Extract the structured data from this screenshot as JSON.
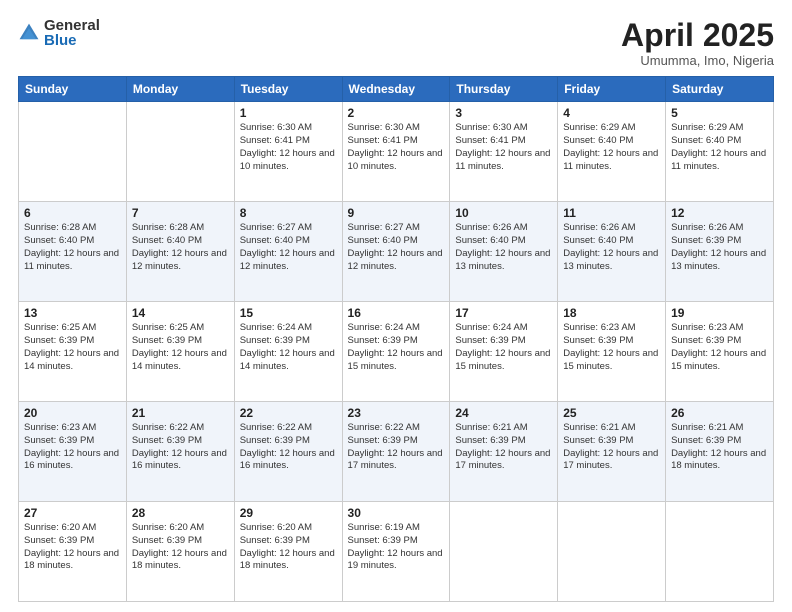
{
  "logo": {
    "general": "General",
    "blue": "Blue"
  },
  "header": {
    "title": "April 2025",
    "subtitle": "Umumma, Imo, Nigeria"
  },
  "weekdays": [
    "Sunday",
    "Monday",
    "Tuesday",
    "Wednesday",
    "Thursday",
    "Friday",
    "Saturday"
  ],
  "weeks": [
    [
      {
        "day": "",
        "sunrise": "",
        "sunset": "",
        "daylight": ""
      },
      {
        "day": "",
        "sunrise": "",
        "sunset": "",
        "daylight": ""
      },
      {
        "day": "1",
        "sunrise": "Sunrise: 6:30 AM",
        "sunset": "Sunset: 6:41 PM",
        "daylight": "Daylight: 12 hours and 10 minutes."
      },
      {
        "day": "2",
        "sunrise": "Sunrise: 6:30 AM",
        "sunset": "Sunset: 6:41 PM",
        "daylight": "Daylight: 12 hours and 10 minutes."
      },
      {
        "day": "3",
        "sunrise": "Sunrise: 6:30 AM",
        "sunset": "Sunset: 6:41 PM",
        "daylight": "Daylight: 12 hours and 11 minutes."
      },
      {
        "day": "4",
        "sunrise": "Sunrise: 6:29 AM",
        "sunset": "Sunset: 6:40 PM",
        "daylight": "Daylight: 12 hours and 11 minutes."
      },
      {
        "day": "5",
        "sunrise": "Sunrise: 6:29 AM",
        "sunset": "Sunset: 6:40 PM",
        "daylight": "Daylight: 12 hours and 11 minutes."
      }
    ],
    [
      {
        "day": "6",
        "sunrise": "Sunrise: 6:28 AM",
        "sunset": "Sunset: 6:40 PM",
        "daylight": "Daylight: 12 hours and 11 minutes."
      },
      {
        "day": "7",
        "sunrise": "Sunrise: 6:28 AM",
        "sunset": "Sunset: 6:40 PM",
        "daylight": "Daylight: 12 hours and 12 minutes."
      },
      {
        "day": "8",
        "sunrise": "Sunrise: 6:27 AM",
        "sunset": "Sunset: 6:40 PM",
        "daylight": "Daylight: 12 hours and 12 minutes."
      },
      {
        "day": "9",
        "sunrise": "Sunrise: 6:27 AM",
        "sunset": "Sunset: 6:40 PM",
        "daylight": "Daylight: 12 hours and 12 minutes."
      },
      {
        "day": "10",
        "sunrise": "Sunrise: 6:26 AM",
        "sunset": "Sunset: 6:40 PM",
        "daylight": "Daylight: 12 hours and 13 minutes."
      },
      {
        "day": "11",
        "sunrise": "Sunrise: 6:26 AM",
        "sunset": "Sunset: 6:40 PM",
        "daylight": "Daylight: 12 hours and 13 minutes."
      },
      {
        "day": "12",
        "sunrise": "Sunrise: 6:26 AM",
        "sunset": "Sunset: 6:39 PM",
        "daylight": "Daylight: 12 hours and 13 minutes."
      }
    ],
    [
      {
        "day": "13",
        "sunrise": "Sunrise: 6:25 AM",
        "sunset": "Sunset: 6:39 PM",
        "daylight": "Daylight: 12 hours and 14 minutes."
      },
      {
        "day": "14",
        "sunrise": "Sunrise: 6:25 AM",
        "sunset": "Sunset: 6:39 PM",
        "daylight": "Daylight: 12 hours and 14 minutes."
      },
      {
        "day": "15",
        "sunrise": "Sunrise: 6:24 AM",
        "sunset": "Sunset: 6:39 PM",
        "daylight": "Daylight: 12 hours and 14 minutes."
      },
      {
        "day": "16",
        "sunrise": "Sunrise: 6:24 AM",
        "sunset": "Sunset: 6:39 PM",
        "daylight": "Daylight: 12 hours and 15 minutes."
      },
      {
        "day": "17",
        "sunrise": "Sunrise: 6:24 AM",
        "sunset": "Sunset: 6:39 PM",
        "daylight": "Daylight: 12 hours and 15 minutes."
      },
      {
        "day": "18",
        "sunrise": "Sunrise: 6:23 AM",
        "sunset": "Sunset: 6:39 PM",
        "daylight": "Daylight: 12 hours and 15 minutes."
      },
      {
        "day": "19",
        "sunrise": "Sunrise: 6:23 AM",
        "sunset": "Sunset: 6:39 PM",
        "daylight": "Daylight: 12 hours and 15 minutes."
      }
    ],
    [
      {
        "day": "20",
        "sunrise": "Sunrise: 6:23 AM",
        "sunset": "Sunset: 6:39 PM",
        "daylight": "Daylight: 12 hours and 16 minutes."
      },
      {
        "day": "21",
        "sunrise": "Sunrise: 6:22 AM",
        "sunset": "Sunset: 6:39 PM",
        "daylight": "Daylight: 12 hours and 16 minutes."
      },
      {
        "day": "22",
        "sunrise": "Sunrise: 6:22 AM",
        "sunset": "Sunset: 6:39 PM",
        "daylight": "Daylight: 12 hours and 16 minutes."
      },
      {
        "day": "23",
        "sunrise": "Sunrise: 6:22 AM",
        "sunset": "Sunset: 6:39 PM",
        "daylight": "Daylight: 12 hours and 17 minutes."
      },
      {
        "day": "24",
        "sunrise": "Sunrise: 6:21 AM",
        "sunset": "Sunset: 6:39 PM",
        "daylight": "Daylight: 12 hours and 17 minutes."
      },
      {
        "day": "25",
        "sunrise": "Sunrise: 6:21 AM",
        "sunset": "Sunset: 6:39 PM",
        "daylight": "Daylight: 12 hours and 17 minutes."
      },
      {
        "day": "26",
        "sunrise": "Sunrise: 6:21 AM",
        "sunset": "Sunset: 6:39 PM",
        "daylight": "Daylight: 12 hours and 18 minutes."
      }
    ],
    [
      {
        "day": "27",
        "sunrise": "Sunrise: 6:20 AM",
        "sunset": "Sunset: 6:39 PM",
        "daylight": "Daylight: 12 hours and 18 minutes."
      },
      {
        "day": "28",
        "sunrise": "Sunrise: 6:20 AM",
        "sunset": "Sunset: 6:39 PM",
        "daylight": "Daylight: 12 hours and 18 minutes."
      },
      {
        "day": "29",
        "sunrise": "Sunrise: 6:20 AM",
        "sunset": "Sunset: 6:39 PM",
        "daylight": "Daylight: 12 hours and 18 minutes."
      },
      {
        "day": "30",
        "sunrise": "Sunrise: 6:19 AM",
        "sunset": "Sunset: 6:39 PM",
        "daylight": "Daylight: 12 hours and 19 minutes."
      },
      {
        "day": "",
        "sunrise": "",
        "sunset": "",
        "daylight": ""
      },
      {
        "day": "",
        "sunrise": "",
        "sunset": "",
        "daylight": ""
      },
      {
        "day": "",
        "sunrise": "",
        "sunset": "",
        "daylight": ""
      }
    ]
  ]
}
